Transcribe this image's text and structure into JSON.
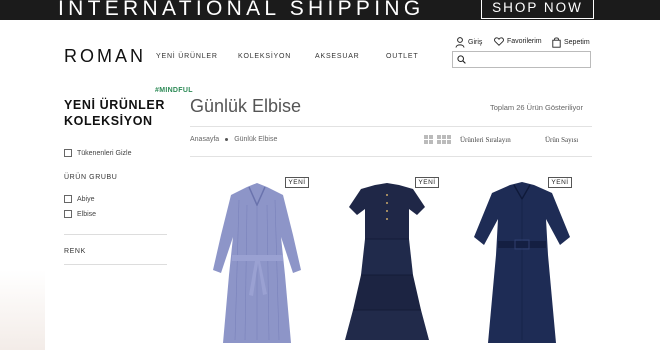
{
  "banner": {
    "text": "INTERNATIONAL SHIPPING",
    "cta": "SHOP NOW"
  },
  "header": {
    "logo": "ROMAN",
    "nav": [
      "YENİ ÜRÜNLER",
      "KOLEKSİYON",
      "AKSESUAR",
      "OUTLET"
    ],
    "login": "Giriş",
    "favorites": "Favorilerim",
    "cart": "Sepetim",
    "search_placeholder": ""
  },
  "sidebar": {
    "title_line1": "YENİ ÜRÜNLER",
    "title_line2": "KOLEKSİYON",
    "tag": "#MINDFUL",
    "hide_out_of_stock": "Tükenenleri Gizle",
    "group_label": "ÜRÜN GRUBU",
    "groups": [
      "Abiye",
      "Elbise"
    ],
    "color_label": "RENK"
  },
  "main": {
    "title": "Günlük Elbise",
    "count": "Toplam 26 Ürün Gösteriliyor",
    "breadcrumb": [
      "Anasayfa",
      "Günlük Elbise"
    ],
    "sort_label": "Ürünleri Sıralayın",
    "per_page_label": "Ürün Sayısı"
  },
  "products": [
    {
      "badge": "YENİ",
      "color": "#8d95c8",
      "icon": "striped-shirt-dress"
    },
    {
      "badge": "YENİ",
      "color": "#1f2747",
      "icon": "tiered-navy-dress"
    },
    {
      "badge": "YENİ",
      "color": "#1e2c55",
      "icon": "belted-navy-shirt-dress"
    }
  ]
}
